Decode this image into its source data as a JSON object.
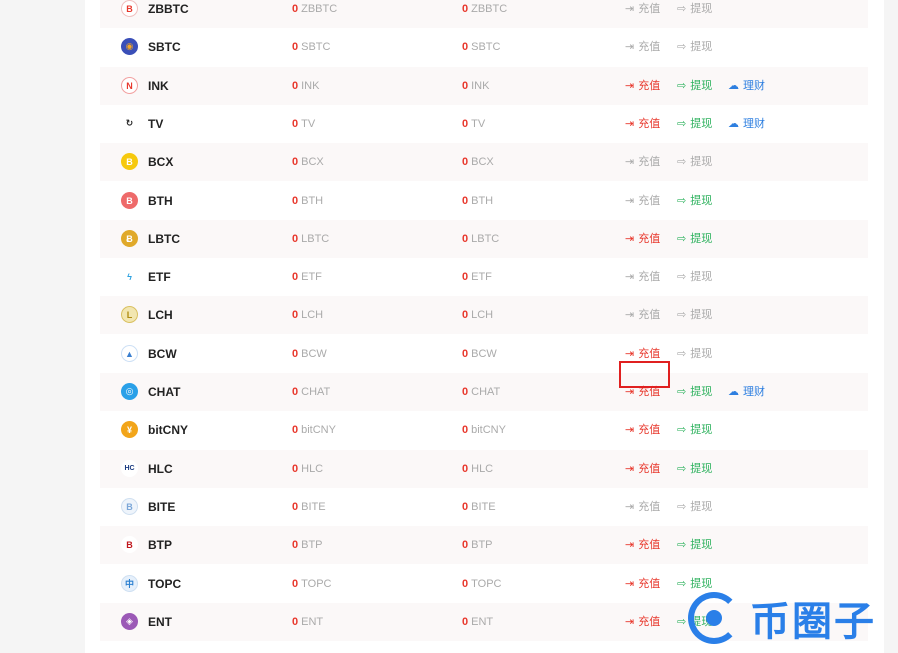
{
  "rows": [
    {
      "symbol": "ZBBTC",
      "bal1": "0",
      "bal2": "0",
      "deposit": "充值",
      "withdraw": "提现",
      "finance": "",
      "dep_on": false,
      "wd_on": false,
      "icon": {
        "bg": "#ffffff",
        "fg": "#e8372c",
        "glyph": "B",
        "border": "#f0c0c0"
      }
    },
    {
      "symbol": "SBTC",
      "bal1": "0",
      "bal2": "0",
      "deposit": "充值",
      "withdraw": "提现",
      "finance": "",
      "dep_on": false,
      "wd_on": false,
      "icon": {
        "bg": "#3a4fb8",
        "fg": "#f5a623",
        "glyph": "◉",
        "border": "#3a4fb8"
      }
    },
    {
      "symbol": "INK",
      "bal1": "0",
      "bal2": "0",
      "deposit": "充值",
      "withdraw": "提现",
      "finance": "理财",
      "dep_on": true,
      "wd_on": true,
      "icon": {
        "bg": "#ffffff",
        "fg": "#e8372c",
        "glyph": "N",
        "border": "#f2a0a0"
      }
    },
    {
      "symbol": "TV",
      "bal1": "0",
      "bal2": "0",
      "deposit": "充值",
      "withdraw": "提现",
      "finance": "理财",
      "dep_on": true,
      "wd_on": true,
      "icon": {
        "bg": "#ffffff",
        "fg": "#222222",
        "glyph": "↻",
        "border": "#ffffff"
      }
    },
    {
      "symbol": "BCX",
      "bal1": "0",
      "bal2": "0",
      "deposit": "充值",
      "withdraw": "提现",
      "finance": "",
      "dep_on": false,
      "wd_on": false,
      "icon": {
        "bg": "#f6c90e",
        "fg": "#ffffff",
        "glyph": "B",
        "border": "#f6c90e"
      }
    },
    {
      "symbol": "BTH",
      "bal1": "0",
      "bal2": "0",
      "deposit": "充值",
      "withdraw": "提现",
      "finance": "",
      "dep_on": false,
      "wd_on": true,
      "icon": {
        "bg": "#ee6a6a",
        "fg": "#ffffff",
        "glyph": "B",
        "border": "#ee6a6a"
      }
    },
    {
      "symbol": "LBTC",
      "bal1": "0",
      "bal2": "0",
      "deposit": "充值",
      "withdraw": "提现",
      "finance": "",
      "dep_on": true,
      "wd_on": true,
      "icon": {
        "bg": "#e0a92a",
        "fg": "#ffffff",
        "glyph": "Ƀ",
        "border": "#e0a92a"
      }
    },
    {
      "symbol": "ETF",
      "bal1": "0",
      "bal2": "0",
      "deposit": "充值",
      "withdraw": "提现",
      "finance": "",
      "dep_on": false,
      "wd_on": false,
      "icon": {
        "bg": "#ffffff",
        "fg": "#2aa0e0",
        "glyph": "ϟ",
        "border": "#ffffff"
      }
    },
    {
      "symbol": "LCH",
      "bal1": "0",
      "bal2": "0",
      "deposit": "充值",
      "withdraw": "提现",
      "finance": "",
      "dep_on": false,
      "wd_on": false,
      "icon": {
        "bg": "#f2e6b0",
        "fg": "#b08a10",
        "glyph": "L",
        "border": "#d9c060"
      }
    },
    {
      "symbol": "BCW",
      "bal1": "0",
      "bal2": "0",
      "deposit": "充值",
      "withdraw": "提现",
      "finance": "",
      "dep_on": true,
      "wd_on": false,
      "icon": {
        "bg": "#ffffff",
        "fg": "#3a7fd0",
        "glyph": "▲",
        "border": "#cde0f5"
      }
    },
    {
      "symbol": "CHAT",
      "bal1": "0",
      "bal2": "0",
      "deposit": "充值",
      "withdraw": "提现",
      "finance": "理财",
      "dep_on": true,
      "wd_on": true,
      "icon": {
        "bg": "#2aa0e8",
        "fg": "#ffffff",
        "glyph": "◎",
        "border": "#2aa0e8"
      }
    },
    {
      "symbol": "bitCNY",
      "bal1": "0",
      "bal2": "0",
      "deposit": "充值",
      "withdraw": "提现",
      "finance": "",
      "dep_on": true,
      "wd_on": true,
      "icon": {
        "bg": "#f2a51a",
        "fg": "#ffffff",
        "glyph": "¥",
        "border": "#f2a51a"
      }
    },
    {
      "symbol": "HLC",
      "bal1": "0",
      "bal2": "0",
      "deposit": "充值",
      "withdraw": "提现",
      "finance": "",
      "dep_on": true,
      "wd_on": true,
      "icon": {
        "bg": "#ffffff",
        "fg": "#1a3a80",
        "glyph": "HC",
        "border": "#ffffff"
      }
    },
    {
      "symbol": "BITE",
      "bal1": "0",
      "bal2": "0",
      "deposit": "充值",
      "withdraw": "提现",
      "finance": "",
      "dep_on": false,
      "wd_on": false,
      "icon": {
        "bg": "#eef4fb",
        "fg": "#7aa6d8",
        "glyph": "B",
        "border": "#cfdff0"
      }
    },
    {
      "symbol": "BTP",
      "bal1": "0",
      "bal2": "0",
      "deposit": "充值",
      "withdraw": "提现",
      "finance": "",
      "dep_on": true,
      "wd_on": true,
      "icon": {
        "bg": "#ffffff",
        "fg": "#c0161c",
        "glyph": "B",
        "border": "#ffffff"
      }
    },
    {
      "symbol": "TOPC",
      "bal1": "0",
      "bal2": "0",
      "deposit": "充值",
      "withdraw": "提现",
      "finance": "",
      "dep_on": true,
      "wd_on": true,
      "icon": {
        "bg": "#e6f0fb",
        "fg": "#2a7fd0",
        "glyph": "中",
        "border": "#cfe0f2"
      }
    },
    {
      "symbol": "ENT",
      "bal1": "0",
      "bal2": "0",
      "deposit": "充值",
      "withdraw": "提现",
      "finance": "",
      "dep_on": true,
      "wd_on": true,
      "icon": {
        "bg": "#9b59b6",
        "fg": "#ffffff",
        "glyph": "◈",
        "border": "#9b59b6"
      }
    }
  ],
  "watermark": {
    "text": "币圈子"
  },
  "colors": {
    "deposit": "#e8372c",
    "withdraw": "#2eb25e",
    "finance": "#2e7fe0",
    "disabled": "#aaaaaa",
    "highlight": "#e02020"
  }
}
